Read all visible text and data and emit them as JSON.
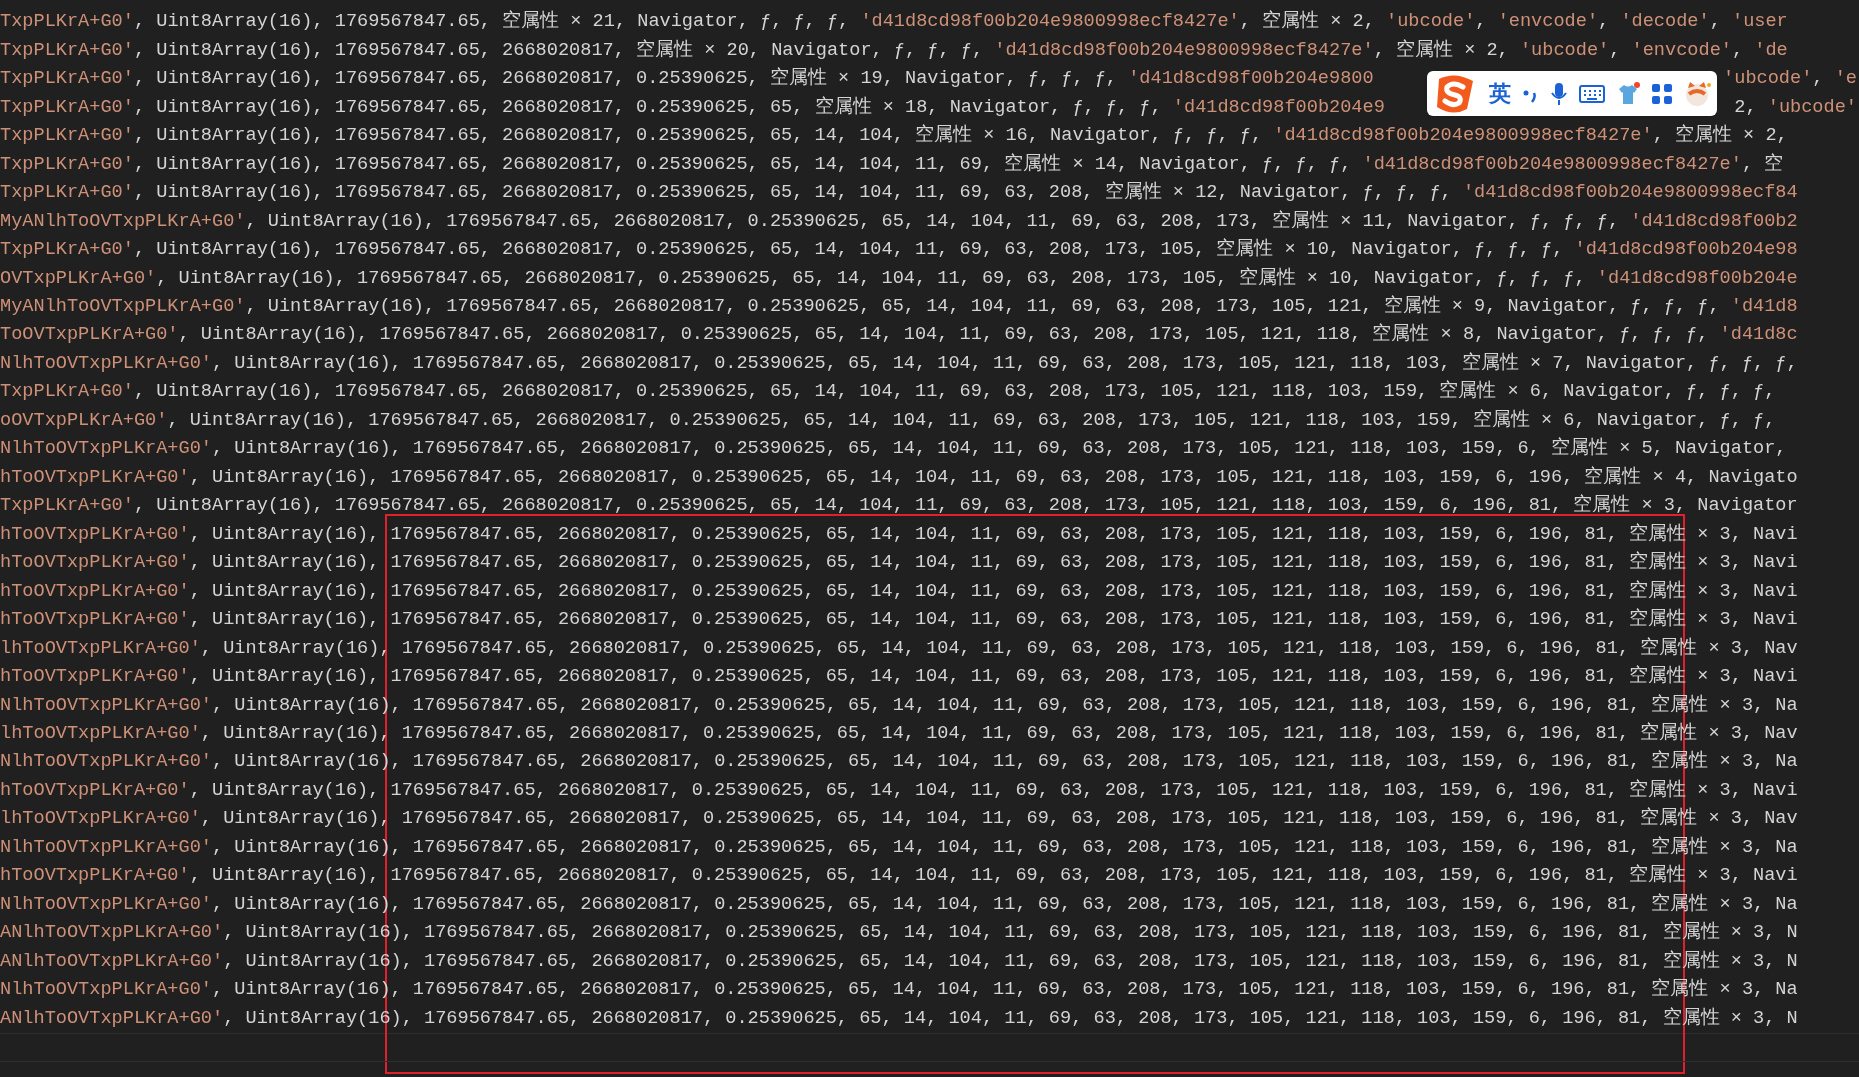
{
  "console": {
    "lines": [
      {
        "segments": [
          {
            "kind": "string",
            "text": "TxpPLKrA+G0'"
          },
          {
            "kind": "text",
            "text": ", Uint8Array(16), 1769567847.65, 空属性 × 21, Navigator, ƒ, ƒ, ƒ, "
          },
          {
            "kind": "string",
            "text": "'d41d8cd98f00b204e9800998ecf8427e'"
          },
          {
            "kind": "text",
            "text": ", 空属性 × 2, "
          },
          {
            "kind": "string",
            "text": "'ubcode'"
          },
          {
            "kind": "text",
            "text": ", "
          },
          {
            "kind": "string",
            "text": "'envcode'"
          },
          {
            "kind": "text",
            "text": ", "
          },
          {
            "kind": "string",
            "text": "'decode'"
          },
          {
            "kind": "text",
            "text": ", "
          },
          {
            "kind": "string",
            "text": "'user"
          }
        ]
      },
      {
        "segments": [
          {
            "kind": "string",
            "text": "TxpPLKrA+G0'"
          },
          {
            "kind": "text",
            "text": ", Uint8Array(16), 1769567847.65, 2668020817, 空属性 × 20, Navigator, ƒ, ƒ, ƒ, "
          },
          {
            "kind": "string",
            "text": "'d41d8cd98f00b204e9800998ecf8427e'"
          },
          {
            "kind": "text",
            "text": ", 空属性 × 2, "
          },
          {
            "kind": "string",
            "text": "'ubcode'"
          },
          {
            "kind": "text",
            "text": ", "
          },
          {
            "kind": "string",
            "text": "'envcode'"
          },
          {
            "kind": "text",
            "text": ", "
          },
          {
            "kind": "string",
            "text": "'de"
          }
        ]
      },
      {
        "segments": [
          {
            "kind": "string",
            "text": "TxpPLKrA+G0'"
          },
          {
            "kind": "text",
            "text": ", Uint8Array(16), 1769567847.65, 2668020817, 0.25390625, 空属性 × 19, Navigator, ƒ, ƒ, ƒ, "
          },
          {
            "kind": "string",
            "text": "'d41d8cd98f00b204e9800"
          }
        ],
        "tail": [
          {
            "kind": "string",
            "text": "'ubcode'"
          },
          {
            "kind": "text",
            "text": ", "
          },
          {
            "kind": "string",
            "text": "'e"
          }
        ]
      },
      {
        "segments": [
          {
            "kind": "string",
            "text": "TxpPLKrA+G0'"
          },
          {
            "kind": "text",
            "text": ", Uint8Array(16), 1769567847.65, 2668020817, 0.25390625, 65, 空属性 × 18, Navigator, ƒ, ƒ, ƒ, "
          },
          {
            "kind": "string",
            "text": "'d41d8cd98f00b204e9"
          }
        ],
        "tail": [
          {
            "kind": "text",
            "text": "2, "
          },
          {
            "kind": "string",
            "text": "'ubcode'"
          }
        ]
      },
      {
        "segments": [
          {
            "kind": "string",
            "text": "TxpPLKrA+G0'"
          },
          {
            "kind": "text",
            "text": ", Uint8Array(16), 1769567847.65, 2668020817, 0.25390625, 65, 14, 104, 空属性 × 16, Navigator, ƒ, ƒ, ƒ, "
          },
          {
            "kind": "string",
            "text": "'d41d8cd98f00b204e9800998ecf8427e'"
          },
          {
            "kind": "text",
            "text": ", 空属性 × 2,"
          }
        ]
      },
      {
        "segments": [
          {
            "kind": "string",
            "text": "TxpPLKrA+G0'"
          },
          {
            "kind": "text",
            "text": ", Uint8Array(16), 1769567847.65, 2668020817, 0.25390625, 65, 14, 104, 11, 69, 空属性 × 14, Navigator, ƒ, ƒ, ƒ, "
          },
          {
            "kind": "string",
            "text": "'d41d8cd98f00b204e9800998ecf8427e'"
          },
          {
            "kind": "text",
            "text": ", 空"
          }
        ]
      },
      {
        "segments": [
          {
            "kind": "string",
            "text": "TxpPLKrA+G0'"
          },
          {
            "kind": "text",
            "text": ", Uint8Array(16), 1769567847.65, 2668020817, 0.25390625, 65, 14, 104, 11, 69, 63, 208, 空属性 × 12, Navigator, ƒ, ƒ, ƒ, "
          },
          {
            "kind": "string",
            "text": "'d41d8cd98f00b204e9800998ecf84"
          }
        ]
      },
      {
        "segments": [
          {
            "kind": "string",
            "text": "MyANlhToOVTxpPLKrA+G0'"
          },
          {
            "kind": "text",
            "text": ", Uint8Array(16), 1769567847.65, 2668020817, 0.25390625, 65, 14, 104, 11, 69, 63, 208, 173, 空属性 × 11, Navigator, ƒ, ƒ, ƒ, "
          },
          {
            "kind": "string",
            "text": "'d41d8cd98f00b2"
          }
        ]
      },
      {
        "segments": [
          {
            "kind": "string",
            "text": "TxpPLKrA+G0'"
          },
          {
            "kind": "text",
            "text": ", Uint8Array(16), 1769567847.65, 2668020817, 0.25390625, 65, 14, 104, 11, 69, 63, 208, 173, 105, 空属性 × 10, Navigator, ƒ, ƒ, ƒ, "
          },
          {
            "kind": "string",
            "text": "'d41d8cd98f00b204e98"
          }
        ]
      },
      {
        "segments": [
          {
            "kind": "string",
            "text": "OVTxpPLKrA+G0'"
          },
          {
            "kind": "text",
            "text": ", Uint8Array(16), 1769567847.65, 2668020817, 0.25390625, 65, 14, 104, 11, 69, 63, 208, 173, 105, 空属性 × 10, Navigator, ƒ, ƒ, ƒ, "
          },
          {
            "kind": "string",
            "text": "'d41d8cd98f00b204e"
          }
        ]
      },
      {
        "segments": [
          {
            "kind": "string",
            "text": "MyANlhToOVTxpPLKrA+G0'"
          },
          {
            "kind": "text",
            "text": ", Uint8Array(16), 1769567847.65, 2668020817, 0.25390625, 65, 14, 104, 11, 69, 63, 208, 173, 105, 121, 空属性 × 9, Navigator, ƒ, ƒ, ƒ, "
          },
          {
            "kind": "string",
            "text": "'d41d8"
          }
        ]
      },
      {
        "segments": [
          {
            "kind": "string",
            "text": "ToOVTxpPLKrA+G0'"
          },
          {
            "kind": "text",
            "text": ", Uint8Array(16), 1769567847.65, 2668020817, 0.25390625, 65, 14, 104, 11, 69, 63, 208, 173, 105, 121, 118, 空属性 × 8, Navigator, ƒ, ƒ, ƒ, "
          },
          {
            "kind": "string",
            "text": "'d41d8c"
          }
        ]
      },
      {
        "segments": [
          {
            "kind": "string",
            "text": "NlhToOVTxpPLKrA+G0'"
          },
          {
            "kind": "text",
            "text": ", Uint8Array(16), 1769567847.65, 2668020817, 0.25390625, 65, 14, 104, 11, 69, 63, 208, 173, 105, 121, 118, 103, 空属性 × 7, Navigator, ƒ, ƒ, ƒ,"
          }
        ]
      },
      {
        "segments": [
          {
            "kind": "string",
            "text": "TxpPLKrA+G0'"
          },
          {
            "kind": "text",
            "text": ", Uint8Array(16), 1769567847.65, 2668020817, 0.25390625, 65, 14, 104, 11, 69, 63, 208, 173, 105, 121, 118, 103, 159, 空属性 × 6, Navigator, ƒ, ƒ, ƒ,"
          }
        ]
      },
      {
        "segments": [
          {
            "kind": "string",
            "text": "oOVTxpPLKrA+G0'"
          },
          {
            "kind": "text",
            "text": ", Uint8Array(16), 1769567847.65, 2668020817, 0.25390625, 65, 14, 104, 11, 69, 63, 208, 173, 105, 121, 118, 103, 159, 空属性 × 6, Navigator, ƒ, ƒ,"
          }
        ]
      },
      {
        "segments": [
          {
            "kind": "string",
            "text": "NlhToOVTxpPLKrA+G0'"
          },
          {
            "kind": "text",
            "text": ", Uint8Array(16), 1769567847.65, 2668020817, 0.25390625, 65, 14, 104, 11, 69, 63, 208, 173, 105, 121, 118, 103, 159, 6, 空属性 × 5, Navigator,"
          }
        ]
      },
      {
        "segments": [
          {
            "kind": "string",
            "text": "hToOVTxpPLKrA+G0'"
          },
          {
            "kind": "text",
            "text": ", Uint8Array(16), 1769567847.65, 2668020817, 0.25390625, 65, 14, 104, 11, 69, 63, 208, 173, 105, 121, 118, 103, 159, 6, 196, 空属性 × 4, Navigato"
          }
        ]
      },
      {
        "segments": [
          {
            "kind": "string",
            "text": "TxpPLKrA+G0'"
          },
          {
            "kind": "text",
            "text": ", Uint8Array(16), 1769567847.65, 2668020817, 0.25390625, 65, 14, 104, 11, 69, 63, 208, 173, 105, 121, 118, 103, 159, 6, 196, 81, 空属性 × 3, Navigator"
          }
        ]
      },
      {
        "segments": [
          {
            "kind": "string",
            "text": "hToOVTxpPLKrA+G0'"
          },
          {
            "kind": "text",
            "text": ", Uint8Array(16), 1769567847.65, 2668020817, 0.25390625, 65, 14, 104, 11, 69, 63, 208, 173, 105, 121, 118, 103, 159, 6, 196, 81, 空属性 × 3, Navi"
          }
        ]
      },
      {
        "segments": [
          {
            "kind": "string",
            "text": "hToOVTxpPLKrA+G0'"
          },
          {
            "kind": "text",
            "text": ", Uint8Array(16), 1769567847.65, 2668020817, 0.25390625, 65, 14, 104, 11, 69, 63, 208, 173, 105, 121, 118, 103, 159, 6, 196, 81, 空属性 × 3, Navi"
          }
        ]
      },
      {
        "segments": [
          {
            "kind": "string",
            "text": "hToOVTxpPLKrA+G0'"
          },
          {
            "kind": "text",
            "text": ", Uint8Array(16), 1769567847.65, 2668020817, 0.25390625, 65, 14, 104, 11, 69, 63, 208, 173, 105, 121, 118, 103, 159, 6, 196, 81, 空属性 × 3, Navi"
          }
        ]
      },
      {
        "segments": [
          {
            "kind": "string",
            "text": "hToOVTxpPLKrA+G0'"
          },
          {
            "kind": "text",
            "text": ", Uint8Array(16), 1769567847.65, 2668020817, 0.25390625, 65, 14, 104, 11, 69, 63, 208, 173, 105, 121, 118, 103, 159, 6, 196, 81, 空属性 × 3, Navi"
          }
        ]
      },
      {
        "segments": [
          {
            "kind": "string",
            "text": "lhToOVTxpPLKrA+G0'"
          },
          {
            "kind": "text",
            "text": ", Uint8Array(16), 1769567847.65, 2668020817, 0.25390625, 65, 14, 104, 11, 69, 63, 208, 173, 105, 121, 118, 103, 159, 6, 196, 81, 空属性 × 3, Nav"
          }
        ]
      },
      {
        "segments": [
          {
            "kind": "string",
            "text": "hToOVTxpPLKrA+G0'"
          },
          {
            "kind": "text",
            "text": ", Uint8Array(16), 1769567847.65, 2668020817, 0.25390625, 65, 14, 104, 11, 69, 63, 208, 173, 105, 121, 118, 103, 159, 6, 196, 81, 空属性 × 3, Navi"
          }
        ]
      },
      {
        "segments": [
          {
            "kind": "string",
            "text": "NlhToOVTxpPLKrA+G0'"
          },
          {
            "kind": "text",
            "text": ", Uint8Array(16), 1769567847.65, 2668020817, 0.25390625, 65, 14, 104, 11, 69, 63, 208, 173, 105, 121, 118, 103, 159, 6, 196, 81, 空属性 × 3, Na"
          }
        ]
      },
      {
        "segments": [
          {
            "kind": "string",
            "text": "lhToOVTxpPLKrA+G0'"
          },
          {
            "kind": "text",
            "text": ", Uint8Array(16), 1769567847.65, 2668020817, 0.25390625, 65, 14, 104, 11, 69, 63, 208, 173, 105, 121, 118, 103, 159, 6, 196, 81, 空属性 × 3, Nav"
          }
        ]
      },
      {
        "segments": [
          {
            "kind": "string",
            "text": "NlhToOVTxpPLKrA+G0'"
          },
          {
            "kind": "text",
            "text": ", Uint8Array(16), 1769567847.65, 2668020817, 0.25390625, 65, 14, 104, 11, 69, 63, 208, 173, 105, 121, 118, 103, 159, 6, 196, 81, 空属性 × 3, Na"
          }
        ]
      },
      {
        "segments": [
          {
            "kind": "string",
            "text": "hToOVTxpPLKrA+G0'"
          },
          {
            "kind": "text",
            "text": ", Uint8Array(16), 1769567847.65, 2668020817, 0.25390625, 65, 14, 104, 11, 69, 63, 208, 173, 105, 121, 118, 103, 159, 6, 196, 81, 空属性 × 3, Navi"
          }
        ]
      },
      {
        "segments": [
          {
            "kind": "string",
            "text": "lhToOVTxpPLKrA+G0'"
          },
          {
            "kind": "text",
            "text": ", Uint8Array(16), 1769567847.65, 2668020817, 0.25390625, 65, 14, 104, 11, 69, 63, 208, 173, 105, 121, 118, 103, 159, 6, 196, 81, 空属性 × 3, Nav"
          }
        ]
      },
      {
        "segments": [
          {
            "kind": "string",
            "text": "NlhToOVTxpPLKrA+G0'"
          },
          {
            "kind": "text",
            "text": ", Uint8Array(16), 1769567847.65, 2668020817, 0.25390625, 65, 14, 104, 11, 69, 63, 208, 173, 105, 121, 118, 103, 159, 6, 196, 81, 空属性 × 3, Na"
          }
        ]
      },
      {
        "segments": [
          {
            "kind": "string",
            "text": "hToOVTxpPLKrA+G0'"
          },
          {
            "kind": "text",
            "text": ", Uint8Array(16), 1769567847.65, 2668020817, 0.25390625, 65, 14, 104, 11, 69, 63, 208, 173, 105, 121, 118, 103, 159, 6, 196, 81, 空属性 × 3, Navi"
          }
        ]
      },
      {
        "segments": [
          {
            "kind": "string",
            "text": "NlhToOVTxpPLKrA+G0'"
          },
          {
            "kind": "text",
            "text": ", Uint8Array(16), 1769567847.65, 2668020817, 0.25390625, 65, 14, 104, 11, 69, 63, 208, 173, 105, 121, 118, 103, 159, 6, 196, 81, 空属性 × 3, Na"
          }
        ]
      },
      {
        "segments": [
          {
            "kind": "string",
            "text": "ANlhToOVTxpPLKrA+G0'"
          },
          {
            "kind": "text",
            "text": ", Uint8Array(16), 1769567847.65, 2668020817, 0.25390625, 65, 14, 104, 11, 69, 63, 208, 173, 105, 121, 118, 103, 159, 6, 196, 81, 空属性 × 3, N"
          }
        ]
      },
      {
        "segments": [
          {
            "kind": "string",
            "text": "ANlhToOVTxpPLKrA+G0'"
          },
          {
            "kind": "text",
            "text": ", Uint8Array(16), 1769567847.65, 2668020817, 0.25390625, 65, 14, 104, 11, 69, 63, 208, 173, 105, 121, 118, 103, 159, 6, 196, 81, 空属性 × 3, N"
          }
        ]
      },
      {
        "segments": [
          {
            "kind": "string",
            "text": "NlhToOVTxpPLKrA+G0'"
          },
          {
            "kind": "text",
            "text": ", Uint8Array(16), 1769567847.65, 2668020817, 0.25390625, 65, 14, 104, 11, 69, 63, 208, 173, 105, 121, 118, 103, 159, 6, 196, 81, 空属性 × 3, Na"
          }
        ]
      },
      {
        "segments": [
          {
            "kind": "string",
            "text": "ANlhToOVTxpPLKrA+G0'"
          },
          {
            "kind": "text",
            "text": ", Uint8Array(16), 1769567847.65, 2668020817, 0.25390625, 65, 14, 104, 11, 69, 63, 208, 173, 105, 121, 118, 103, 159, 6, 196, 81, 空属性 × 3, N"
          }
        ]
      }
    ]
  },
  "ime_toolbar": {
    "mode_label": "英"
  }
}
